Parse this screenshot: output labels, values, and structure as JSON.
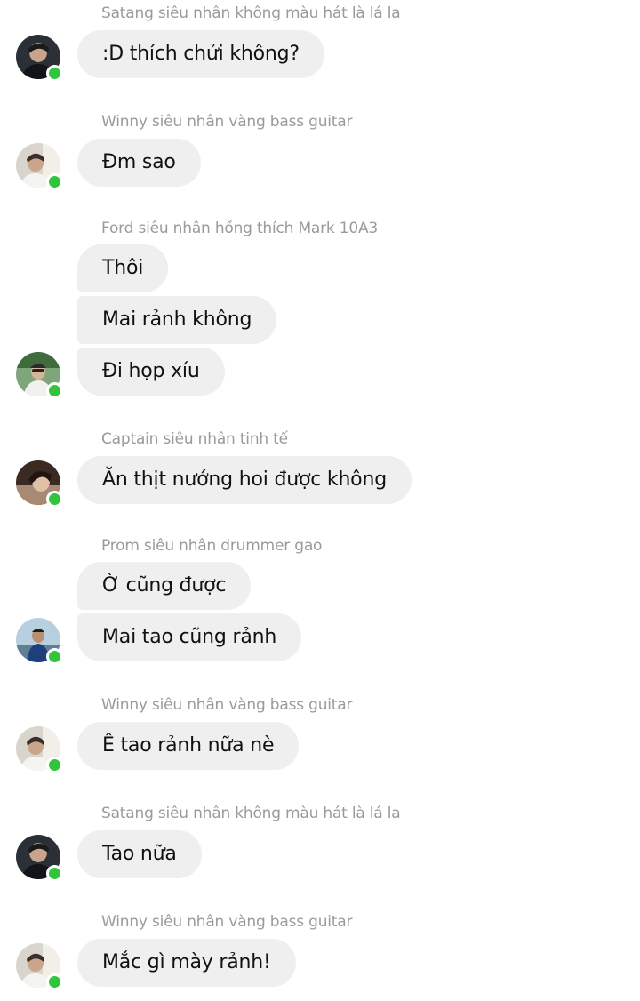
{
  "chat": {
    "groups": [
      {
        "sender": "Satang siêu nhân không màu hát là lá la",
        "avatar": "satang-avatar",
        "messages": [
          ":D thích chửi không?"
        ]
      },
      {
        "sender": "Winny siêu nhân vàng bass guitar",
        "avatar": "winny-avatar",
        "messages": [
          "Đm sao"
        ]
      },
      {
        "sender": "Ford siêu nhân hồng thích Mark 10A3",
        "avatar": "ford-avatar",
        "messages": [
          "Thôi",
          "Mai rảnh không",
          "Đi họp xíu"
        ]
      },
      {
        "sender": "Captain siêu nhân tinh tế",
        "avatar": "captain-avatar",
        "messages": [
          "Ăn thịt nướng hoi được không"
        ]
      },
      {
        "sender": "Prom siêu nhân drummer gao",
        "avatar": "prom-avatar",
        "messages": [
          "Ờ cũng được",
          "Mai tao cũng rảnh"
        ]
      },
      {
        "sender": "Winny siêu nhân vàng bass guitar",
        "avatar": "winny-avatar",
        "messages": [
          "Ê tao rảnh nữa nè"
        ]
      },
      {
        "sender": "Satang siêu nhân không màu hát là lá la",
        "avatar": "satang-avatar",
        "messages": [
          "Tao nữa"
        ]
      },
      {
        "sender": "Winny siêu nhân vàng bass guitar",
        "avatar": "winny-avatar",
        "messages": [
          "Mắc gì mày rảnh!"
        ]
      }
    ],
    "colors": {
      "bubble": "#efefef",
      "sender_text": "#9a9a9a",
      "online": "#31c53b"
    }
  }
}
